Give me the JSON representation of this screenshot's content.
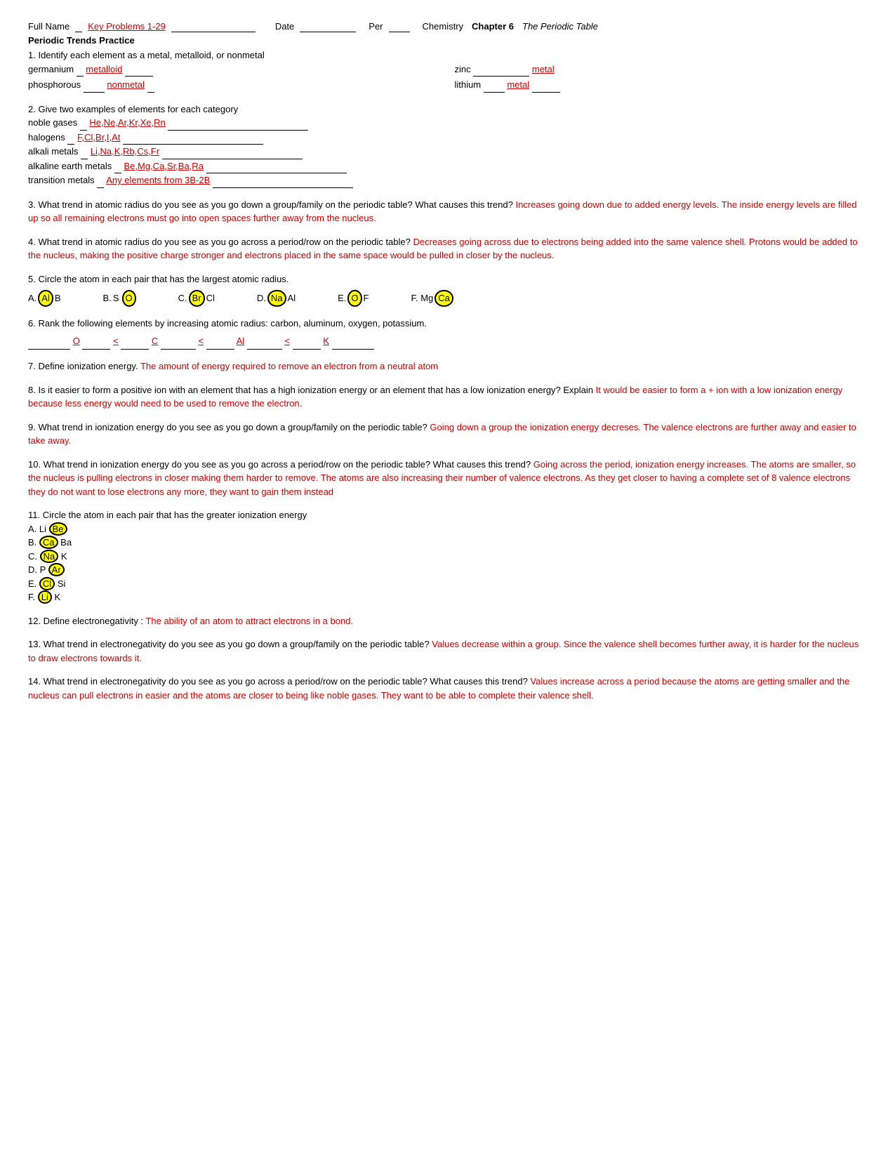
{
  "header": {
    "full_name_label": "Full Name",
    "name_value": "Key Problems 1-29",
    "date_label": "Date",
    "per_label": "Per",
    "course_label": "Chemistry",
    "chapter_label": "Chapter 6",
    "chapter_title": "The Periodic Table"
  },
  "section_title": "Periodic Trends Practice",
  "q1": {
    "text": "1. Identify each element as a metal, metalloid, or nonmetal",
    "germanium_label": "germanium",
    "germanium_answer": "metalloid",
    "zinc_label": "zinc",
    "zinc_answer": "metal",
    "phosphorous_label": "phosphorous",
    "phosphorous_answer": "nonmetal",
    "lithium_label": "lithium",
    "lithium_answer": "metal"
  },
  "q2": {
    "text": "2. Give two examples of elements for each category",
    "noble_gases_label": "noble gases",
    "noble_gases_answer": "He,Ne,Ar,Kr,Xe,Rn",
    "halogens_label": "halogens",
    "halogens_answer": "F,Cl,Br,I,At",
    "alkali_metals_label": "alkali metals",
    "alkali_metals_answer": "Li,Na,K,Rb,Cs,Fr",
    "alkaline_label": "alkaline earth metals",
    "alkaline_answer": "Be,Mg,Ca,Sr,Ba,Ra",
    "transition_label": "transition metals",
    "transition_answer": "Any elements from 3B-2B"
  },
  "q3": {
    "text": "3. What trend in atomic radius do you see as you go down a group/family on the periodic table? What causes this trend?",
    "answer": "Increases going down due to added energy levels.  The inside energy levels are filled up so all remaining electrons must go into open spaces further away from the nucleus."
  },
  "q4": {
    "text": "4. What trend in atomic radius do you see as you go across a period/row on the periodic table?",
    "answer": "Decreases going across due to electrons being added into the same valence shell.  Protons would be added to the nucleus, making the positive charge stronger and electrons placed in the same space would be pulled in closer by the nucleus."
  },
  "q5": {
    "text": "5. Circle the atom in each pair that has the largest atomic radius.",
    "pairs": [
      {
        "id": "A",
        "left": "Al",
        "left_circled": true,
        "right": "B"
      },
      {
        "id": "B",
        "left": "S",
        "left_circled": false,
        "right": "O",
        "right_circled": true
      },
      {
        "id": "C",
        "left": "Br",
        "left_circled": true,
        "right": "Cl"
      },
      {
        "id": "D",
        "left": "Na",
        "left_circled": true,
        "right": "Al"
      },
      {
        "id": "E",
        "left": "O",
        "left_circled": false,
        "right": "F",
        "right_label": "O",
        "left_label": "O"
      },
      {
        "id": "F",
        "left": "Mg",
        "right": "Ca",
        "right_circled": true
      }
    ]
  },
  "q6": {
    "text": "6. Rank the following elements by increasing atomic radius: carbon, aluminum, oxygen, potassium.",
    "ranking": "O < C < Al < K"
  },
  "q7": {
    "text": "7. Define ionization energy.",
    "answer": "The amount of energy required to remove an electron from a neutral atom"
  },
  "q8": {
    "text": "8. Is it easier to form a positive ion with an element that has a high ionization energy or an element that has a low ionization energy? Explain",
    "answer": "It would be easier to form a + ion with a low ionization energy because less energy would need to be used to remove the electron."
  },
  "q9": {
    "text": "9. What trend in ionization energy do you see as you go down a group/family on the periodic table?",
    "answer": "Going down a group the ionization energy decreses.  The valence electrons are further away and easier to take away."
  },
  "q10": {
    "text": "10. What trend in ionization energy do you see as you go across a period/row on the periodic table? What causes this trend?",
    "answer": "Going across the period, ionization energy increases.  The atoms are smaller, so the nucleus is pulling electrons in closer making them harder to remove.  The atoms are also increasing their number of valence electrons.  As they get closer to having a complete set of 8 valence electrons they do not want to lose electrons any more, they want to gain them instead"
  },
  "q11": {
    "text": "11. Circle the atom in each pair that has the greater ionization energy",
    "pairs": [
      {
        "id": "A",
        "text": "A. Li",
        "circled": "Be",
        "rest": ""
      },
      {
        "id": "B",
        "text": "B.",
        "circled": "Ca",
        "rest": "Ba"
      },
      {
        "id": "C",
        "text": "C.",
        "circled": "Na",
        "rest": "K"
      },
      {
        "id": "D",
        "text": "D. P",
        "circled": "Ar",
        "rest": ""
      },
      {
        "id": "E",
        "text": "E.",
        "circled": "Cl",
        "rest": "Si"
      },
      {
        "id": "F",
        "text": "F.",
        "circled": "Li",
        "rest": "K"
      }
    ]
  },
  "q12": {
    "text": "12. Define electronegativity :",
    "answer": "The ability of an atom to attract electrons in a bond."
  },
  "q13": {
    "text": "13. What trend in electronegativity do you see as you go down a group/family on the periodic table?",
    "answer": "Values decrease within a group.  Since the valence shell becomes further away, it is harder for the nucleus to draw electrons towards it."
  },
  "q14": {
    "text": "14. What trend in electronegativity do you see as you go across a period/row on the periodic table? What causes this trend?",
    "answer": "Values increase across a period because the atoms are getting smaller and the nucleus can pull electrons in easier and the atoms are closer to being like noble gases.  They want to be able to complete their valence shell."
  }
}
